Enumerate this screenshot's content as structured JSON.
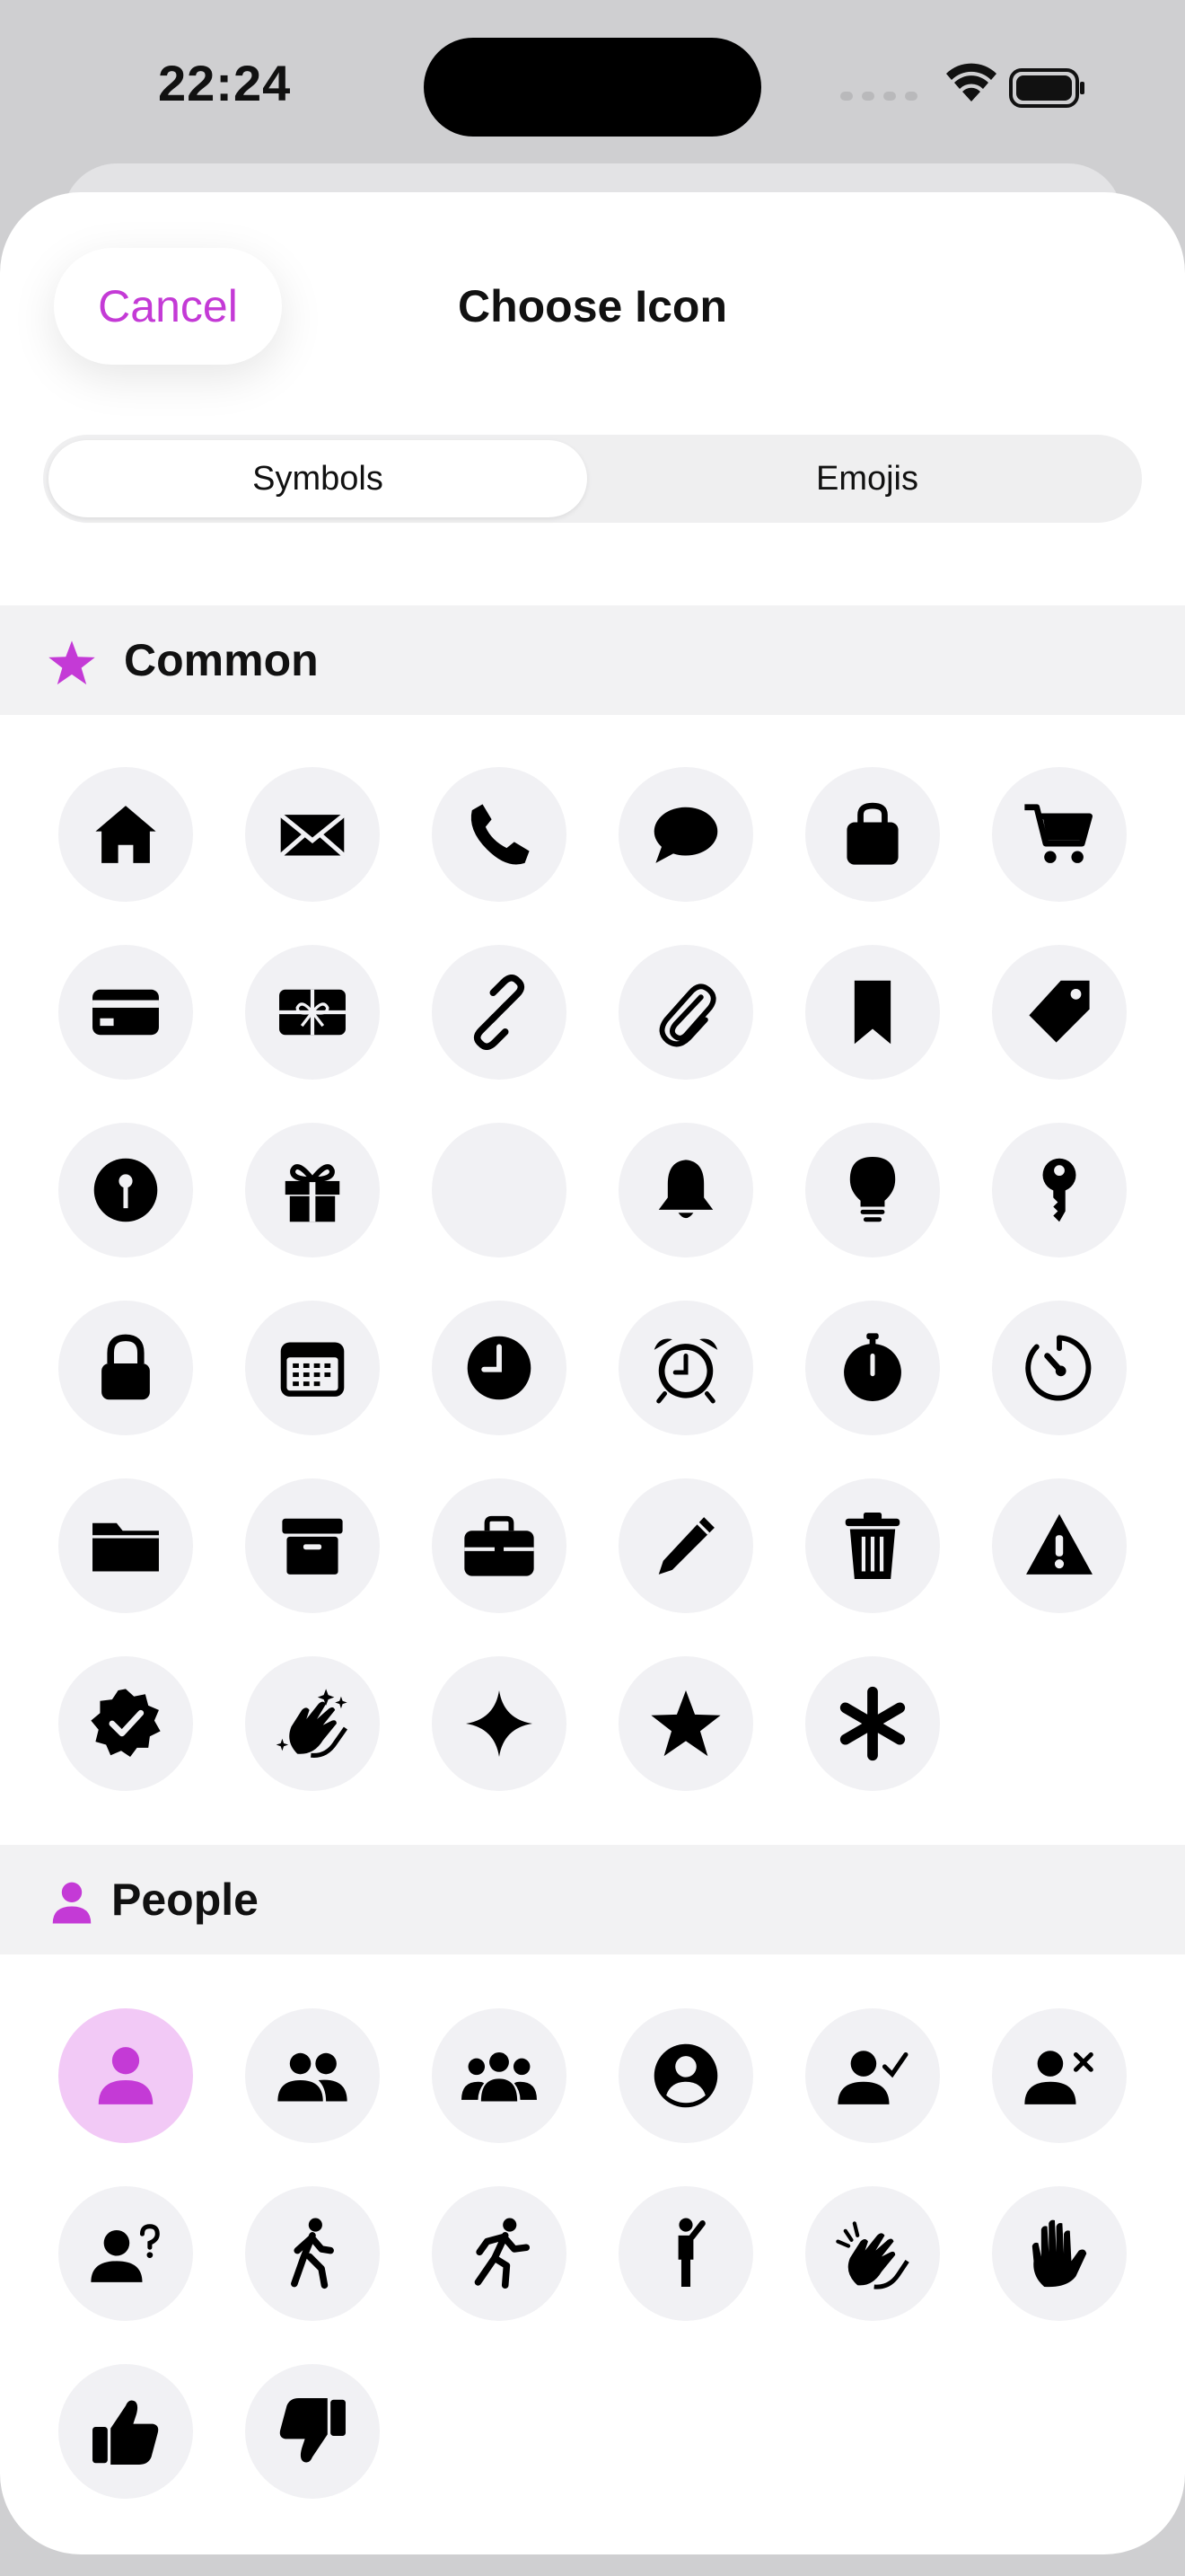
{
  "status_bar": {
    "time": "22:24"
  },
  "header": {
    "cancel_label": "Cancel",
    "title": "Choose Icon"
  },
  "segmented_control": {
    "options": [
      "Symbols",
      "Emojis"
    ],
    "selected": "Symbols"
  },
  "accent_color": "#c43ad6",
  "sections": [
    {
      "title": "Common",
      "icon": "star-icon",
      "icons": [
        "house",
        "envelope",
        "phone",
        "message-bubble",
        "bag",
        "cart",
        "credit-card",
        "gift-card",
        "link",
        "paperclip",
        "bookmark",
        "tag",
        "map-pin-circle",
        "gift",
        "blank",
        "bell",
        "lightbulb",
        "key",
        "lock",
        "calendar",
        "clock",
        "alarm",
        "stopwatch",
        "timer",
        "folder",
        "archive-box",
        "briefcase",
        "pencil",
        "trash",
        "warning-triangle",
        "checkmark-seal",
        "hands-clapping-sparkles",
        "sparkle",
        "star",
        "asterisk"
      ]
    },
    {
      "title": "People",
      "icon": "person-icon",
      "icons": [
        "person",
        "person-2",
        "person-3",
        "person-circle",
        "person-checkmark",
        "person-xmark",
        "person-question",
        "figure-walk",
        "figure-run",
        "figure-stand",
        "hands-clap",
        "hand-raised",
        "thumbs-up",
        "thumbs-down"
      ],
      "selected_icon": "person"
    }
  ]
}
